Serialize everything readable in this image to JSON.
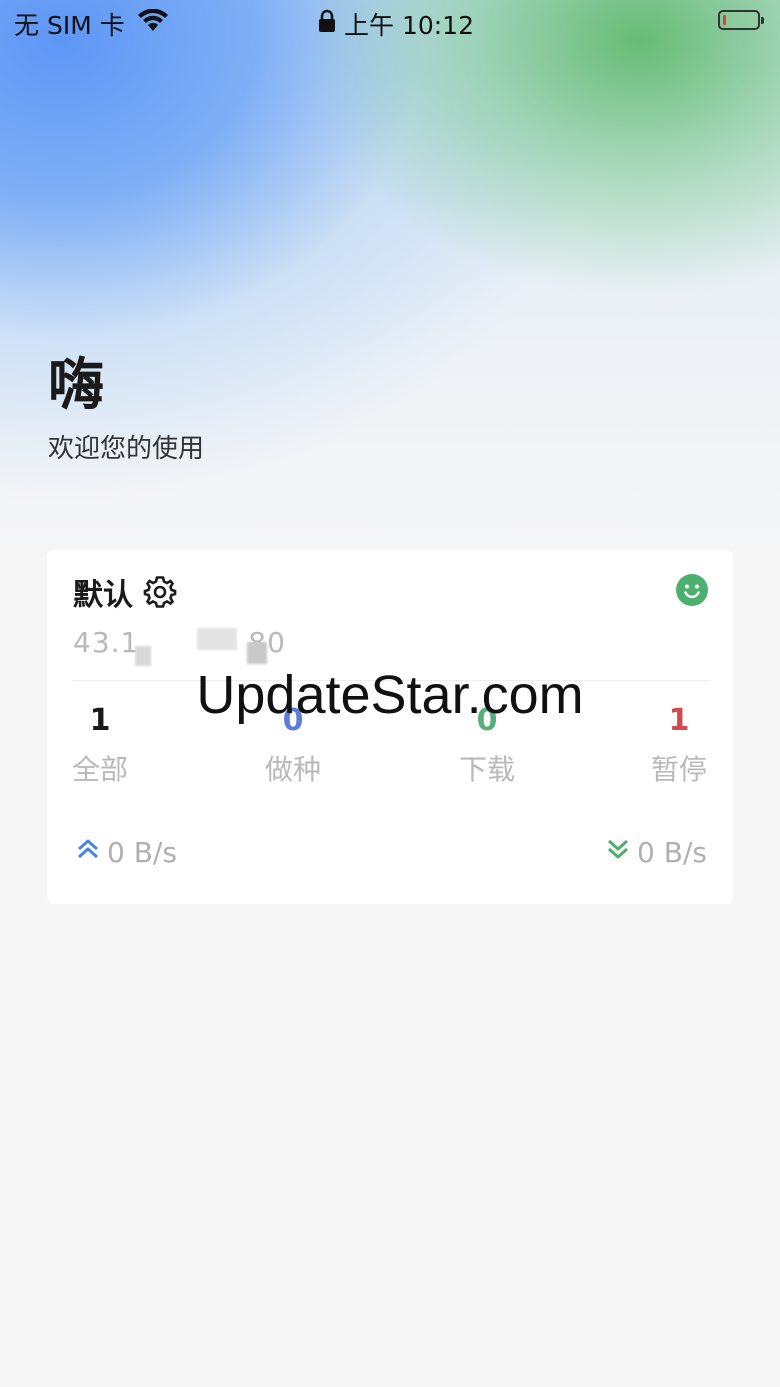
{
  "status_bar": {
    "carrier": "无 SIM 卡",
    "time": "上午 10:12",
    "icons": [
      "wifi-icon",
      "lock-icon",
      "battery-icon"
    ],
    "battery_level": 0.05
  },
  "greeting": {
    "title": "嗨",
    "subtitle": "欢迎您的使用"
  },
  "server_card": {
    "name": "默认",
    "address": "43.1           80",
    "status_icon": "smile-icon",
    "status_color": "#4caf6e",
    "stats": [
      {
        "value": "1",
        "label": "全部",
        "color": "#1a1a1a"
      },
      {
        "value": "0",
        "label": "做种",
        "color": "#5b7fd6"
      },
      {
        "value": "0",
        "label": "下载",
        "color": "#58ad7a"
      },
      {
        "value": "1",
        "label": "暂停",
        "color": "#d24b4b"
      }
    ],
    "upload_speed": "0 B/s",
    "download_speed": "0 B/s"
  },
  "watermark": "UpdateStar.com"
}
